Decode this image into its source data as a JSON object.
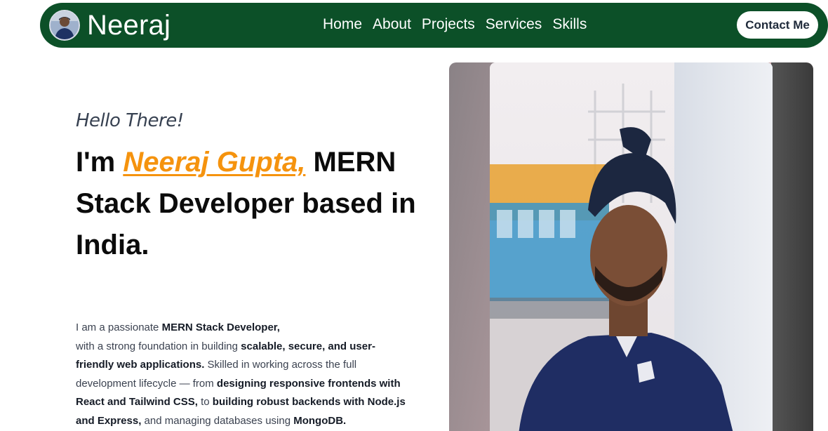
{
  "header": {
    "brand_name": "Neeraj",
    "nav_links": [
      "Home",
      "About",
      "Projects",
      "Services",
      "Skills"
    ],
    "contact_label": "Contact Me"
  },
  "hero": {
    "greeting": "Hello There!",
    "headline_prefix": "I'm ",
    "headline_name": "Neeraj Gupta,",
    "headline_rest": "MERN Stack Developer based in India.",
    "bio": [
      {
        "t": "I am a passionate ",
        "b": false
      },
      {
        "t": "MERN Stack Developer,",
        "b": true
      },
      {
        "t": "with a strong foundation in building ",
        "b": false,
        "br": true
      },
      {
        "t": "scalable, secure, and user-friendly web applications.",
        "b": true
      },
      {
        "t": " Skilled in working across the full development lifecycle — from ",
        "b": false
      },
      {
        "t": "designing responsive frontends with React and Tailwind CSS,",
        "b": true
      },
      {
        "t": " to ",
        "b": false
      },
      {
        "t": "building robust backends with Node.js and Express,",
        "b": true
      },
      {
        "t": " and managing databases using ",
        "b": false
      },
      {
        "t": "MongoDB.",
        "b": true
      }
    ]
  },
  "colors": {
    "nav_bg": "#0c5028",
    "accent": "#f5930e"
  },
  "icons": {
    "avatar": "profile-photo",
    "hero_image": "profile-photo"
  }
}
